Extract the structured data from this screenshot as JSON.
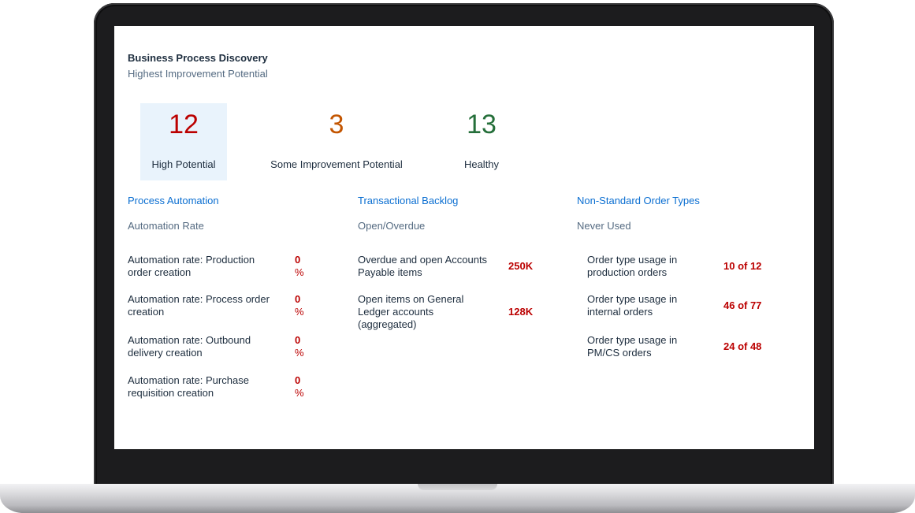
{
  "card": {
    "title": "Business Process Discovery",
    "subtitle": "Highest Improvement Potential"
  },
  "kpis": [
    {
      "value": "12",
      "label": "High Potential",
      "color": "#bb0000",
      "selected": true
    },
    {
      "value": "3",
      "label": "Some Improvement Potential",
      "color": "#c35500",
      "selected": false
    },
    {
      "value": "13",
      "label": "Healthy",
      "color": "#256f3a",
      "selected": false
    }
  ],
  "columns": [
    {
      "header": "Process Automation",
      "subheader": "Automation Rate",
      "rows": [
        {
          "label": "Automation rate: Production order creation",
          "value": "0",
          "unit": "%"
        },
        {
          "label": "Automation rate: Process order creation",
          "value": "0",
          "unit": "%"
        },
        {
          "label": "Automation rate: Outbound delivery creation",
          "value": "0",
          "unit": "%"
        },
        {
          "label": "Automation rate: Purchase requisition creation",
          "value": "0",
          "unit": "%"
        }
      ]
    },
    {
      "header": "Transactional Backlog",
      "subheader": "Open/Overdue",
      "rows": [
        {
          "label": "Overdue and open Accounts Payable items",
          "value": "250K"
        },
        {
          "label": "Open items on General Ledger accounts (aggregated)",
          "value": "128K"
        }
      ]
    },
    {
      "header": "Non-Standard Order Types",
      "subheader": "Never Used",
      "rows": [
        {
          "label": "Order type usage in production orders",
          "value": "10 of 12"
        },
        {
          "label": "Order type usage in internal orders",
          "value": "46 of 77"
        },
        {
          "label": "Order type usage in PM/CS orders",
          "value": "24 of 48"
        }
      ]
    }
  ],
  "colors": {
    "link": "#0a6ed1",
    "critical": "#bb0000",
    "warning": "#c35500",
    "good": "#256f3a"
  }
}
